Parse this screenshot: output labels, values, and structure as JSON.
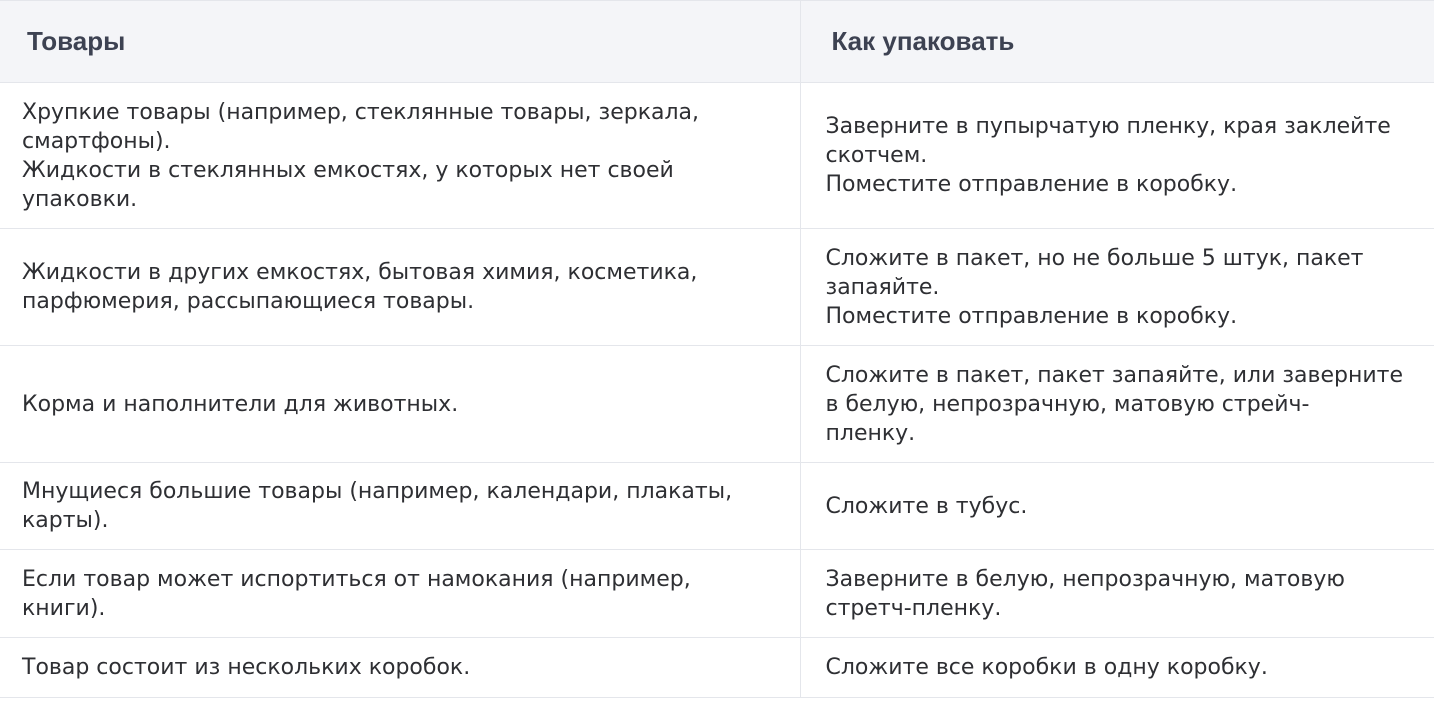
{
  "header": {
    "goods": "Товары",
    "pack": "Как упаковать"
  },
  "rows": [
    {
      "goods": [
        "Хрупкие товары (например, стеклянные товары, зеркала,",
        "смартфоны).",
        "Жидкости в стеклянных емкостях, у которых нет своей",
        "упаковки."
      ],
      "pack": [
        "Заверните в пупырчатую пленку, края заклейте",
        "скотчем.",
        "Поместите отправление в коробку."
      ]
    },
    {
      "goods": [
        "Жидкости в других емкостях, бытовая химия, косметика,",
        "парфюмерия, рассыпающиеся товары."
      ],
      "pack": [
        "Сложите в пакет, но не больше 5 штук, пакет",
        "запаяйте.",
        "Поместите отправление в коробку."
      ]
    },
    {
      "goods": [
        "Корма и наполнители для животных."
      ],
      "pack": [
        "Сложите в пакет, пакет запаяйте, или заверните",
        "в белую, непрозрачную, матовую стрейч-",
        "пленку."
      ]
    },
    {
      "goods": [
        "Мнущиеся большие товары (например, календари, плакаты,",
        "карты)."
      ],
      "pack": [
        "Сложите в тубус."
      ]
    },
    {
      "goods": [
        "Если товар может испортиться от намокания (например,",
        "книги)."
      ],
      "pack": [
        "Заверните в белую, непрозрачную, матовую",
        "стретч-пленку."
      ]
    },
    {
      "goods": [
        "Товар состоит из нескольких коробок."
      ],
      "pack": [
        "Сложите все коробки в одну коробку."
      ]
    }
  ]
}
